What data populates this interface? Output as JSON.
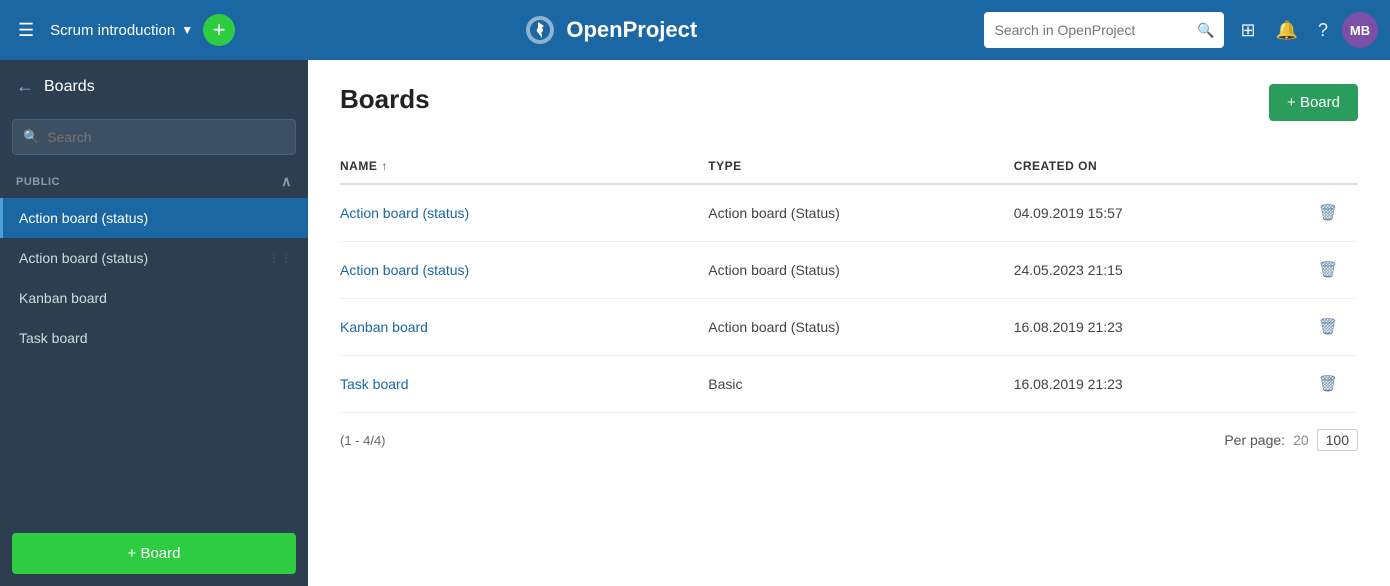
{
  "app": {
    "name": "OpenProject"
  },
  "topnav": {
    "project_name": "Scrum introduction",
    "search_placeholder": "Search in OpenProject",
    "avatar_initials": "MB"
  },
  "sidebar": {
    "section": "Boards",
    "search_placeholder": "Search",
    "group_label": "PUBLIC",
    "items": [
      {
        "label": "Action board (status)",
        "active": true
      },
      {
        "label": "Action board (status)",
        "active": false
      },
      {
        "label": "Kanban board",
        "active": false
      },
      {
        "label": "Task board",
        "active": false
      }
    ],
    "add_button": "+ Board"
  },
  "main": {
    "title": "Boards",
    "add_button": "+ Board",
    "table": {
      "columns": [
        "NAME",
        "TYPE",
        "CREATED ON"
      ],
      "rows": [
        {
          "name": "Action board (status)",
          "type": "Action board (Status)",
          "created_on": "04.09.2019 15:57"
        },
        {
          "name": "Action board (status)",
          "type": "Action board (Status)",
          "created_on": "24.05.2023 21:15"
        },
        {
          "name": "Kanban board",
          "type": "Action board (Status)",
          "created_on": "16.08.2019 21:23"
        },
        {
          "name": "Task board",
          "type": "Basic",
          "created_on": "16.08.2019 21:23"
        }
      ],
      "pagination": "(1 - 4/4)",
      "per_page_label": "Per page:",
      "per_page_20": "20",
      "per_page_100": "100"
    }
  }
}
